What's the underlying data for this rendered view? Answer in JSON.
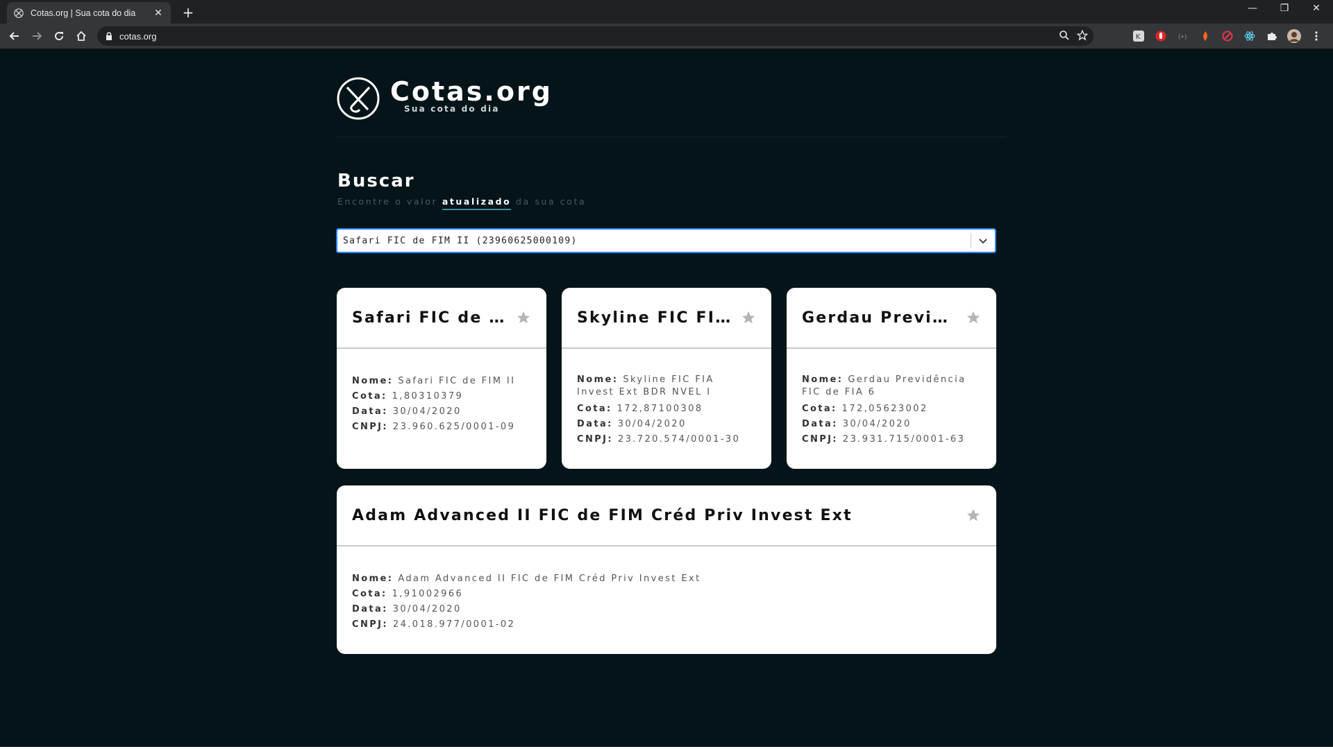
{
  "browser": {
    "tab_title": "Cotas.org | Sua cota do dia",
    "tab_close": "✕",
    "new_tab": "+",
    "url": "cotas.org",
    "window_minimize": "—",
    "window_restore": "❐",
    "window_close": "✕"
  },
  "header": {
    "logo_title": "Cotas.org",
    "logo_subtitle": "Sua cota do dia"
  },
  "search": {
    "title": "Buscar",
    "subtitle_before": "Encontre o valor",
    "subtitle_highlight": "atualizado",
    "subtitle_after": "da sua cota",
    "selected_value": "Safari FIC de FIM II (23960625000109)"
  },
  "cards": [
    {
      "title": "Safari FIC de FI...",
      "nome_label": "Nome:",
      "nome": "Safari FIC de FIM II",
      "cota_label": "Cota:",
      "cota": "1,80310379",
      "data_label": "Data:",
      "data": "30/04/2020",
      "cnpj_label": "CNPJ:",
      "cnpj": "23.960.625/0001-09"
    },
    {
      "title": "Skyline FIC FIA...",
      "nome_label": "Nome:",
      "nome": "Skyline FIC FIA Invest Ext BDR NVEL I",
      "cota_label": "Cota:",
      "cota": "172,87100308",
      "data_label": "Data:",
      "data": "30/04/2020",
      "cnpj_label": "CNPJ:",
      "cnpj": "23.720.574/0001-30"
    },
    {
      "title": "Gerdau Previdên...",
      "nome_label": "Nome:",
      "nome": "Gerdau Previdência FIC de FIA 6",
      "cota_label": "Cota:",
      "cota": "172,05623002",
      "data_label": "Data:",
      "data": "30/04/2020",
      "cnpj_label": "CNPJ:",
      "cnpj": "23.931.715/0001-63"
    },
    {
      "title": "Adam Advanced II FIC de FIM Créd Priv Invest Ext",
      "nome_label": "Nome:",
      "nome": "Adam Advanced II FIC de FIM Créd Priv Invest Ext",
      "cota_label": "Cota:",
      "cota": "1,91002966",
      "data_label": "Data:",
      "data": "30/04/2020",
      "cnpj_label": "CNPJ:",
      "cnpj": "24.018.977/0001-02"
    }
  ],
  "colors": {
    "page_bg": "#041419",
    "accent_underline": "#3f8f9f",
    "select_focus": "#2684ff",
    "star": "#b5b5b5"
  },
  "icons": {
    "favorite": "star-icon",
    "dropdown": "chevron-down-icon"
  }
}
